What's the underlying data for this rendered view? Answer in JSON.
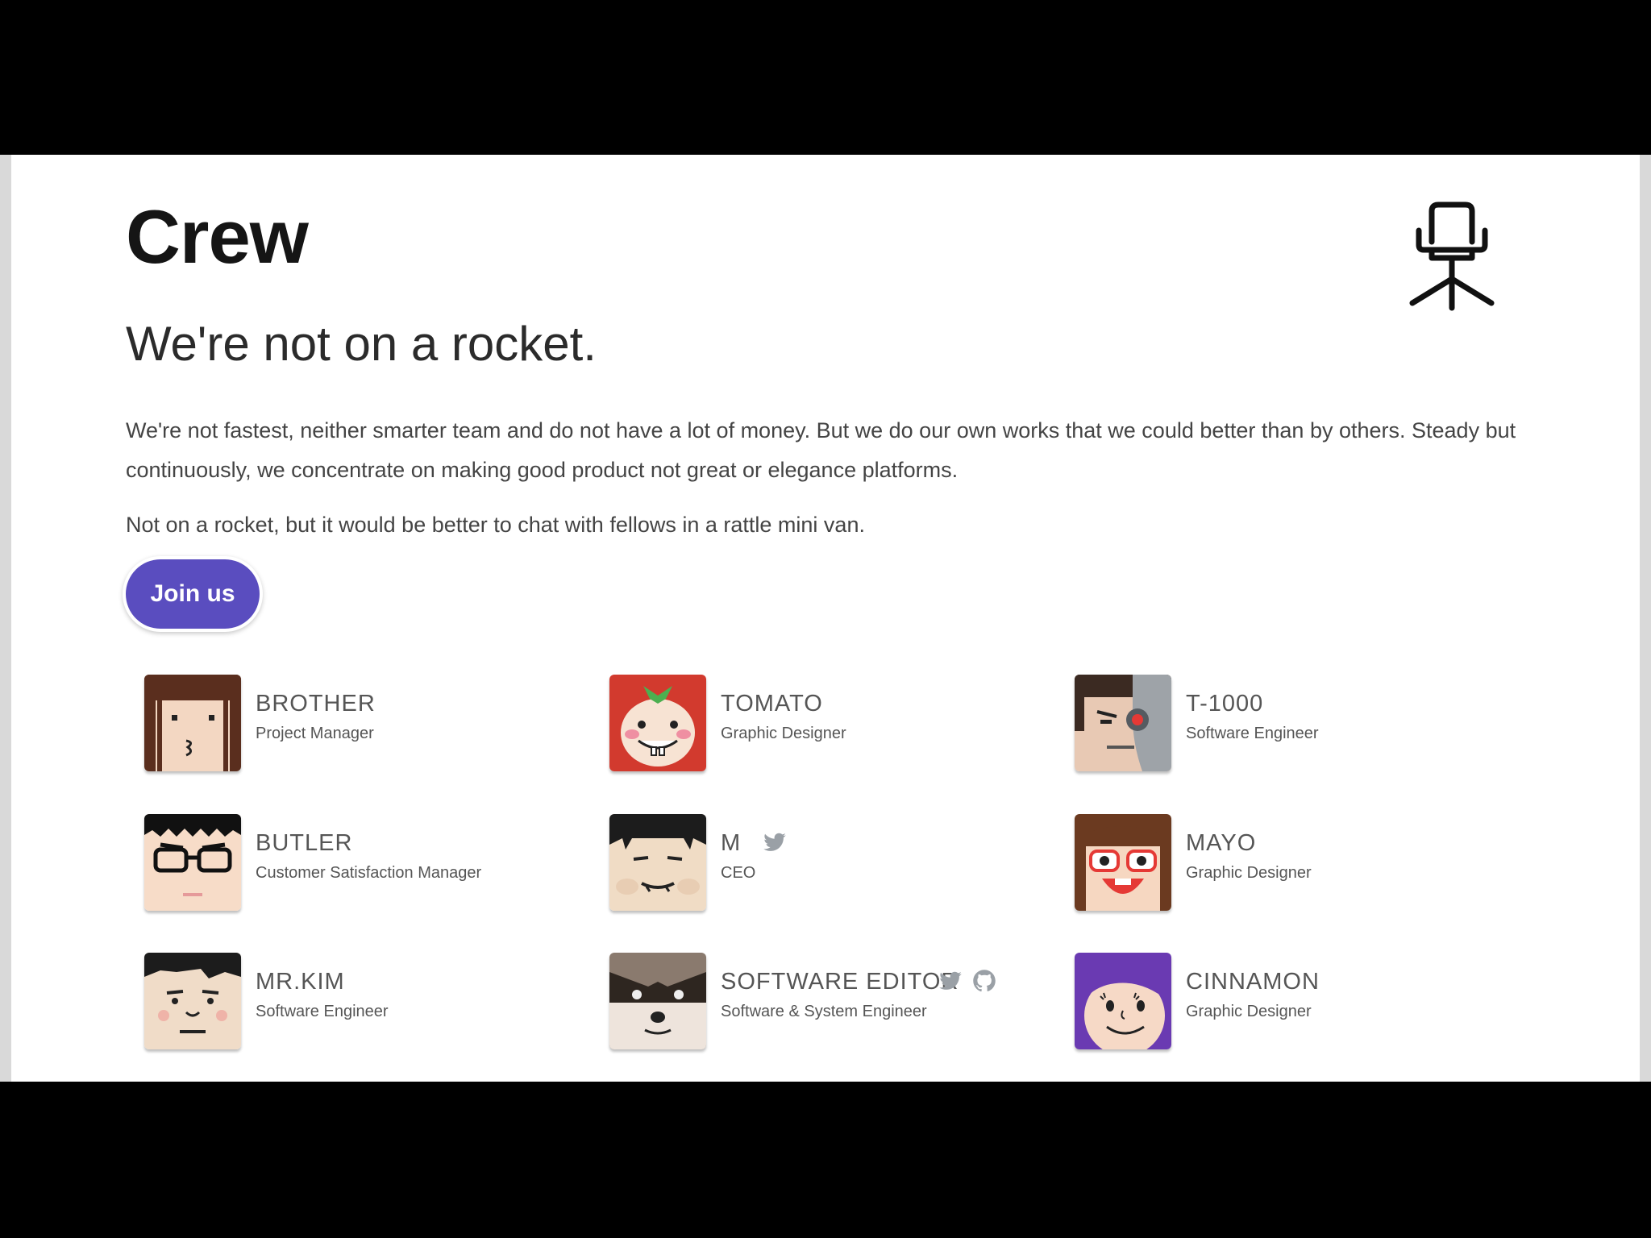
{
  "header": {
    "title": "Crew",
    "logo_icon": "office-chair-icon"
  },
  "intro": {
    "subtitle": "We're not on a rocket.",
    "paragraph_1": "We're not fastest, neither smarter team and do not have a lot of money. But we do our own works that we could better than by others. Steady but continuously, we concentrate on making good product not great or elegance platforms.",
    "paragraph_2": "Not on a rocket, but it would be better to chat with fellows in a rattle mini van.",
    "join_label": "Join us"
  },
  "colors": {
    "accent": "#5a4dbf",
    "social_icon": "#9aa0a6"
  },
  "members": [
    {
      "name": "BROTHER",
      "role": "Project Manager",
      "avatar_icon": "brother-avatar-icon",
      "social": []
    },
    {
      "name": "TOMATO",
      "role": "Graphic Designer",
      "avatar_icon": "tomato-avatar-icon",
      "social": []
    },
    {
      "name": "T-1000",
      "role": "Software Engineer",
      "avatar_icon": "t1000-avatar-icon",
      "social": []
    },
    {
      "name": "BUTLER",
      "role": "Customer Satisfaction Manager",
      "avatar_icon": "butler-avatar-icon",
      "social": []
    },
    {
      "name": "M",
      "role": "CEO",
      "avatar_icon": "m-avatar-icon",
      "social": [
        "twitter-icon"
      ]
    },
    {
      "name": "MAYO",
      "role": "Graphic Designer",
      "avatar_icon": "mayo-avatar-icon",
      "social": []
    },
    {
      "name": "MR.KIM",
      "role": "Software Engineer",
      "avatar_icon": "mrkim-avatar-icon",
      "social": []
    },
    {
      "name": "SOFTWARE EDITOR",
      "role": "Software & System Engineer",
      "avatar_icon": "raccoon-avatar-icon",
      "social": [
        "twitter-icon",
        "github-icon"
      ]
    },
    {
      "name": "CINNAMON",
      "role": "Graphic Designer",
      "avatar_icon": "cinnamon-avatar-icon",
      "social": []
    }
  ]
}
